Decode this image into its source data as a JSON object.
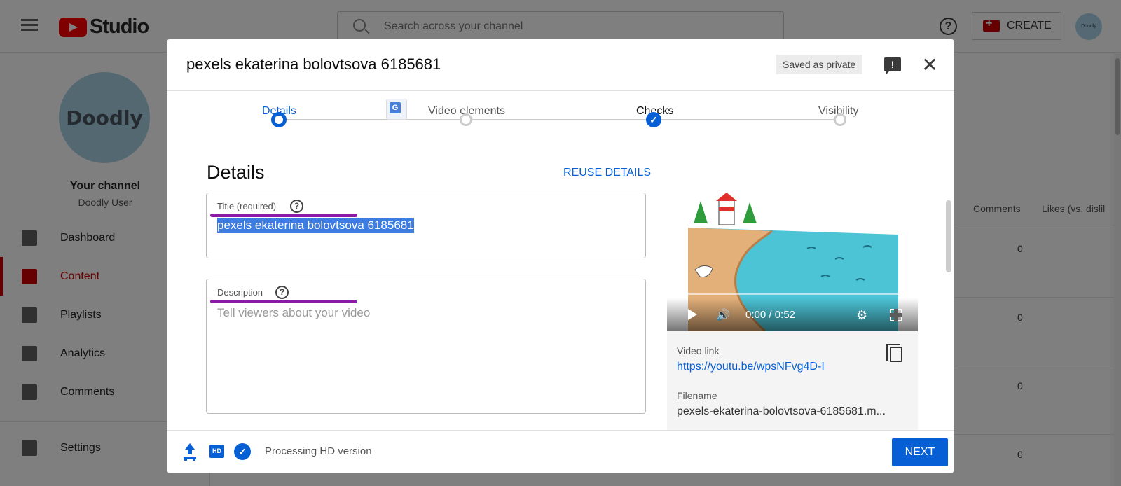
{
  "app": {
    "brand": "Studio",
    "search_placeholder": "Search across your channel",
    "create_label": "CREATE",
    "avatar_text": "Doodly"
  },
  "sidebar": {
    "channel_avatar_text": "Doodly",
    "channel_title": "Your channel",
    "channel_user": "Doodly User",
    "items": [
      {
        "label": "Dashboard",
        "icon": "dashboard-icon"
      },
      {
        "label": "Content",
        "icon": "content-icon",
        "active": true
      },
      {
        "label": "Playlists",
        "icon": "playlists-icon"
      },
      {
        "label": "Analytics",
        "icon": "analytics-icon"
      },
      {
        "label": "Comments",
        "icon": "comments-icon"
      },
      {
        "label": "Settings",
        "icon": "settings-icon"
      }
    ]
  },
  "background_table": {
    "columns": [
      "Comments",
      "Likes (vs. dislil"
    ],
    "comment_counts": [
      "0",
      "0",
      "0",
      "0"
    ]
  },
  "dialog": {
    "title": "pexels ekaterina bolovtsova 6185681",
    "saved_badge": "Saved as private",
    "steps": [
      {
        "label": "Details",
        "state": "current"
      },
      {
        "label": "Video elements",
        "state": "todo"
      },
      {
        "label": "Checks",
        "state": "done"
      },
      {
        "label": "Visibility",
        "state": "todo"
      }
    ],
    "section_title": "Details",
    "reuse_label": "REUSE DETAILS",
    "title_field": {
      "label": "Title (required)",
      "value": "pexels ekaterina bolovtsova 6185681"
    },
    "description_field": {
      "label": "Description",
      "placeholder": "Tell viewers about your video"
    },
    "preview": {
      "time": "0:00 / 0:52",
      "link_label": "Video link",
      "link": "https://youtu.be/wpsNFvg4D-I",
      "filename_label": "Filename",
      "filename": "pexels-ekaterina-bolovtsova-6185681.m..."
    },
    "footer": {
      "hd_label": "HD",
      "status": "Processing HD version",
      "next_label": "NEXT"
    }
  },
  "colors": {
    "accent": "#065fd4",
    "brand_red": "#ff0000",
    "annotation": "#8b1aa6"
  }
}
